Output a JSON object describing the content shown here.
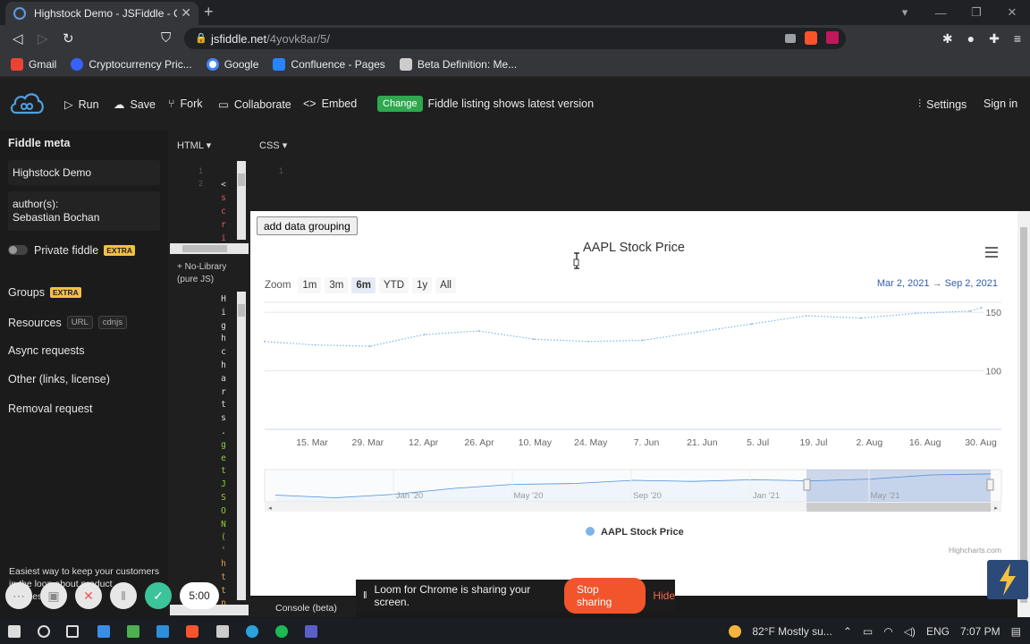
{
  "browser": {
    "tab_title": "Highstock Demo - JSFiddle - Code Playground",
    "url_host": "jsfiddle.net",
    "url_path": "/4yovk8ar/5/",
    "bookmarks": [
      {
        "label": "Gmail",
        "icon": "gmail-icon",
        "color": "#ea4335"
      },
      {
        "label": "Cryptocurrency Pric...",
        "icon": "coinmarketcap-icon",
        "color": "#3861fb"
      },
      {
        "label": "Google",
        "icon": "google-icon",
        "color": "#4285f4"
      },
      {
        "label": "Confluence - Pages",
        "icon": "confluence-icon",
        "color": "#2684ff"
      },
      {
        "label": "Beta Definition: Me...",
        "icon": "investopedia-icon",
        "color": "#cccccc"
      }
    ]
  },
  "jsfiddle": {
    "run": "Run",
    "save": "Save",
    "fork": "Fork",
    "collaborate": "Collaborate",
    "embed": "Embed",
    "change_badge": "Change",
    "listing_note": "Fiddle listing shows latest version",
    "settings": "Settings",
    "signin": "Sign in"
  },
  "sidebar": {
    "heading": "Fiddle meta",
    "fiddle_name": "Highstock Demo",
    "authors_label": "author(s):",
    "author": "Sebastian Bochan",
    "private_label": "Private fiddle",
    "extra_badge": "EXTRA",
    "groups": "Groups",
    "resources": "Resources",
    "url_tag": "URL",
    "cdnjs_tag": "cdnjs",
    "async": "Async requests",
    "other": "Other (links, license)",
    "removal": "Removal request",
    "promo_line1": "Easiest way to keep your customers",
    "promo_line2": "in the loop about product",
    "promo_line3": "updates"
  },
  "editor": {
    "html_label": "HTML",
    "css_label": "CSS",
    "html_line1": "1",
    "html_line2": "2",
    "css_line1": "1",
    "framework_note": "+ No-Library (pure JS)",
    "code_chars_top": [
      "<",
      "s",
      "c",
      "r",
      "i"
    ],
    "code_chars_main": [
      "H",
      "i",
      "g",
      "h",
      "c",
      "h",
      "a",
      "r",
      "t",
      "s",
      ".",
      "g",
      "e",
      "t",
      "J",
      "S",
      "O",
      "N",
      "(",
      "'",
      "h",
      "t",
      "t",
      "p"
    ]
  },
  "result": {
    "grouping_button": "add data grouping",
    "chart_menu_icon": "hamburger-menu-icon",
    "zoom_label": "Zoom",
    "zoom_buttons": [
      "1m",
      "3m",
      "6m",
      "YTD",
      "1y",
      "All"
    ],
    "zoom_selected": "6m",
    "date_from": "Mar 2, 2021",
    "date_arrow": "→",
    "date_to": "Sep 2, 2021",
    "credits": "Highcharts.com"
  },
  "chart_data": {
    "type": "line",
    "title": "AAPL Stock Price",
    "series": [
      {
        "name": "AAPL Stock Price",
        "color": "#7cb5ec",
        "x": [
          "2021-03-02",
          "2021-03-15",
          "2021-03-29",
          "2021-04-12",
          "2021-04-26",
          "2021-05-10",
          "2021-05-24",
          "2021-06-07",
          "2021-06-21",
          "2021-07-05",
          "2021-07-19",
          "2021-08-02",
          "2021-08-16",
          "2021-08-30",
          "2021-09-02"
        ],
        "values": [
          125,
          122,
          121,
          131,
          134,
          127,
          125,
          126,
          133,
          140,
          147,
          145,
          149,
          151,
          154
        ]
      }
    ],
    "xlabel": "",
    "ylabel": "",
    "ylim": [
      50,
      160
    ],
    "y_ticks": [
      "100",
      "150"
    ],
    "x_tick_labels": [
      "15. Mar",
      "29. Mar",
      "12. Apr",
      "26. Apr",
      "10. May",
      "24. May",
      "7. Jun",
      "21. Jun",
      "5. Jul",
      "19. Jul",
      "2. Aug",
      "16. Aug",
      "30. Aug"
    ],
    "navigator_labels": [
      "Jan '20",
      "May '20",
      "Sep '20",
      "Jan '21",
      "May '21"
    ],
    "navigator_values": [
      75,
      65,
      78,
      100,
      115,
      118,
      130,
      126,
      132,
      128,
      135,
      150,
      154
    ],
    "legend": "bottom-center",
    "grid": true
  },
  "loom": {
    "sharing_msg": "Loom for Chrome is sharing your screen.",
    "stop_btn": "Stop sharing",
    "hide_btn": "Hide",
    "timer": "5:00"
  },
  "console_label": "Console (beta)",
  "taskbar": {
    "weather": "82°F  Mostly su...",
    "lang": "ENG",
    "time": "7:07 PM"
  }
}
